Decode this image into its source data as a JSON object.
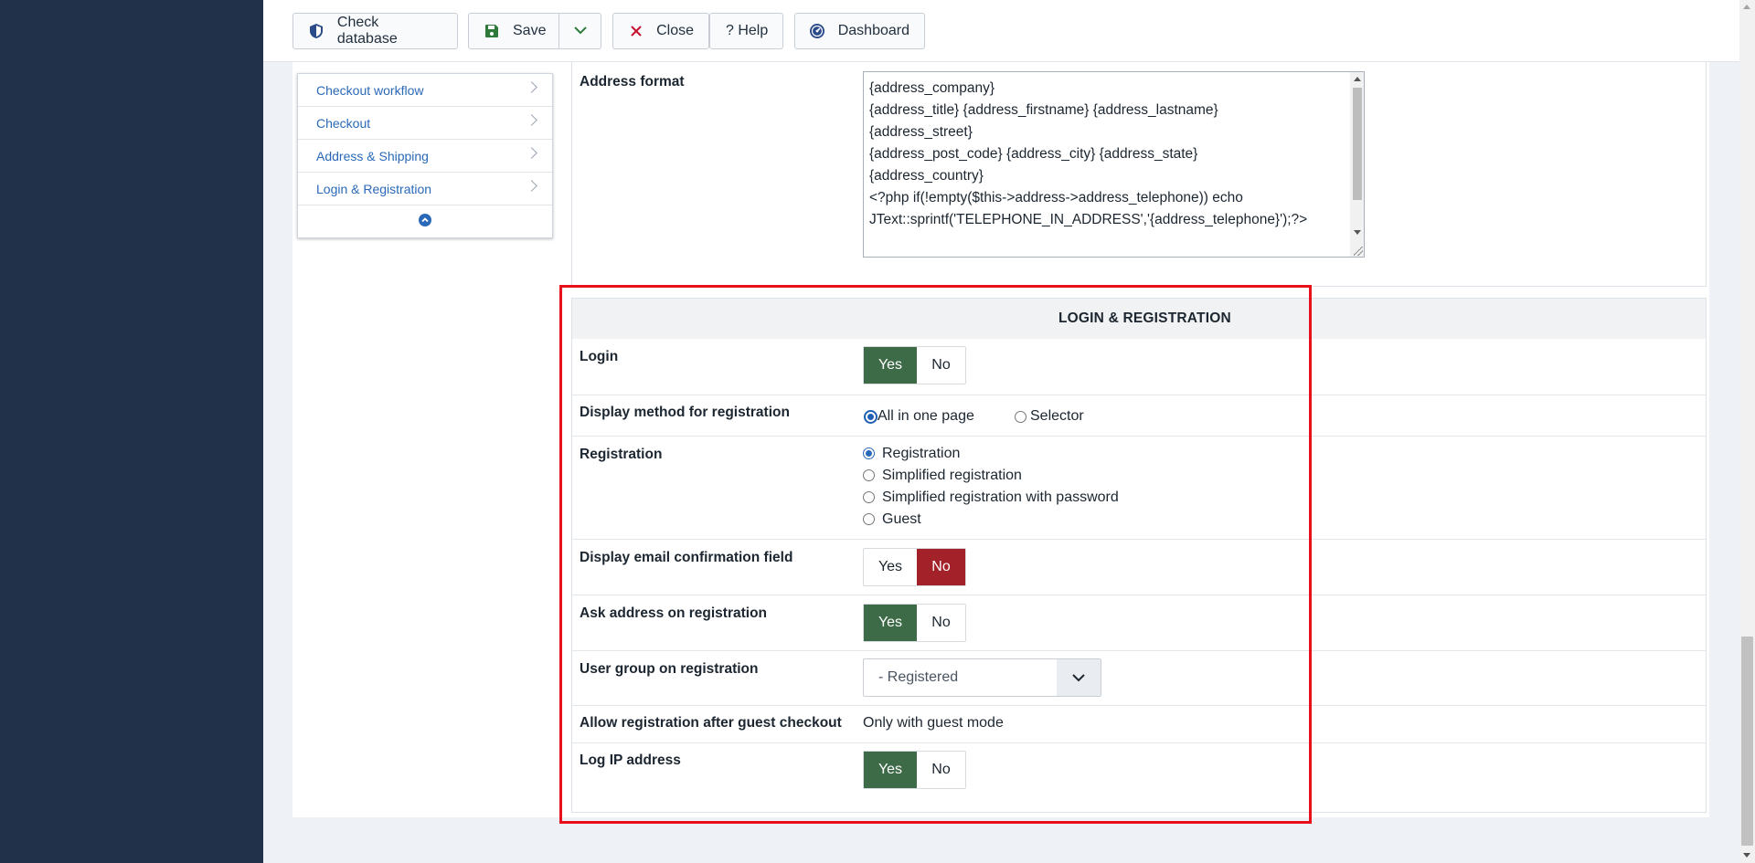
{
  "toolbar": {
    "check_database": "Check database",
    "save": "Save",
    "close": "Close",
    "help": "? Help",
    "dashboard": "Dashboard"
  },
  "side_menu": {
    "items": [
      {
        "label": "Checkout workflow"
      },
      {
        "label": "Checkout"
      },
      {
        "label": "Address & Shipping"
      },
      {
        "label": "Login & Registration"
      }
    ]
  },
  "address_format": {
    "label": "Address format",
    "value": "{address_company}\n{address_title} {address_firstname} {address_lastname}\n{address_street}\n{address_post_code} {address_city} {address_state}\n{address_country}\n<?php if(!empty($this->address->address_telephone)) echo\nJText::sprintf('TELEPHONE_IN_ADDRESS','{address_telephone}');?>"
  },
  "login_registration": {
    "title": "LOGIN & REGISTRATION",
    "login": {
      "label": "Login",
      "yes": "Yes",
      "no": "No",
      "value": "Yes"
    },
    "display_method": {
      "label": "Display method for registration",
      "options": [
        "All in one page",
        "Selector"
      ],
      "selected": "All in one page"
    },
    "registration": {
      "label": "Registration",
      "options": [
        "Registration",
        "Simplified registration",
        "Simplified registration with password",
        "Guest"
      ],
      "selected": "Registration"
    },
    "email_confirm": {
      "label": "Display email confirmation field",
      "yes": "Yes",
      "no": "No",
      "value": "No"
    },
    "ask_address": {
      "label": "Ask address on registration",
      "yes": "Yes",
      "no": "No",
      "value": "Yes"
    },
    "user_group": {
      "label": "User group on registration",
      "value": "- Registered"
    },
    "allow_after_guest": {
      "label": "Allow registration after guest checkout",
      "value": "Only with guest mode"
    },
    "log_ip": {
      "label": "Log IP address",
      "yes": "Yes",
      "no": "No",
      "value": "Yes"
    }
  },
  "colors": {
    "sidebar": "#21314a",
    "yes_active": "#3e6b47",
    "no_active": "#a32128",
    "link": "#2a69b8",
    "highlight": "#e8101a"
  }
}
